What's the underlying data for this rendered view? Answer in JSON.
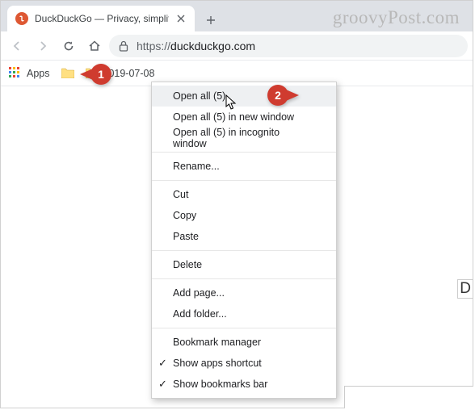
{
  "watermark": "groovyPost.com",
  "tab": {
    "title": "DuckDuckGo — Privacy, simplifie"
  },
  "omnibox": {
    "prefix": "https://",
    "host": "duckduckgo.com"
  },
  "bookmarks": {
    "apps_label": "Apps",
    "folder_label": "2019-07-08"
  },
  "callouts": {
    "one": "1",
    "two": "2"
  },
  "ctx": {
    "open_all": "Open all (5)",
    "open_all_win": "Open all (5) in new window",
    "open_all_inc": "Open all (5) in incognito window",
    "rename": "Rename...",
    "cut": "Cut",
    "copy": "Copy",
    "paste": "Paste",
    "delete": "Delete",
    "add_page": "Add page...",
    "add_folder": "Add folder...",
    "bm_manager": "Bookmark manager",
    "show_apps": "Show apps shortcut",
    "show_bm": "Show bookmarks bar"
  },
  "edge_letter": "D"
}
